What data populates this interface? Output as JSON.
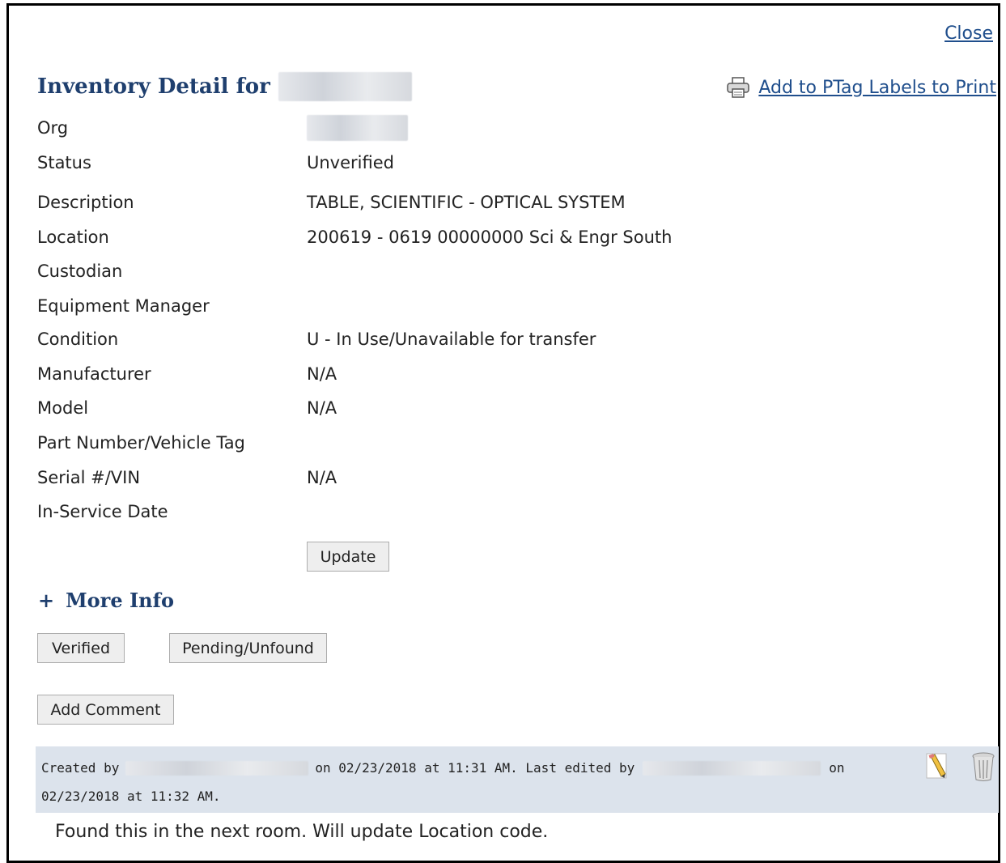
{
  "header": {
    "close_label": "Close",
    "title": "Inventory Detail for",
    "ptag_label": "Add to PTag Labels to Print"
  },
  "details": [
    {
      "label": "Org",
      "value": ""
    },
    {
      "label": "Status",
      "value": "Unverified"
    },
    {
      "label": "Description",
      "value": "TABLE, SCIENTIFIC - OPTICAL SYSTEM"
    },
    {
      "label": "Location",
      "value": "200619 - 0619 00000000 Sci & Engr South"
    },
    {
      "label": "Custodian",
      "value": ""
    },
    {
      "label": "Equipment Manager",
      "value": ""
    },
    {
      "label": "Condition",
      "value": "U - In Use/Unavailable for transfer"
    },
    {
      "label": "Manufacturer",
      "value": "N/A"
    },
    {
      "label": "Model",
      "value": "N/A"
    },
    {
      "label": "Part Number/Vehicle Tag",
      "value": ""
    },
    {
      "label": "Serial #/VIN",
      "value": "N/A"
    },
    {
      "label": "In-Service Date",
      "value": ""
    }
  ],
  "buttons": {
    "update": "Update",
    "verified": "Verified",
    "pending": "Pending/Unfound",
    "add_comment": "Add Comment"
  },
  "more_info": {
    "toggle": "+",
    "label": "More Info"
  },
  "comment": {
    "created_by_prefix": "Created by",
    "created_on": "on 02/23/2018 at 11:31 AM. Last edited by",
    "edited_on_prefix": "on",
    "edited_date": "02/23/2018 at 11:32 AM.",
    "text": "Found this in the next room. Will update Location code."
  },
  "colors": {
    "heading": "#1f3f6e",
    "link": "#1f4e8c",
    "comment_bg": "#dce3ec"
  }
}
